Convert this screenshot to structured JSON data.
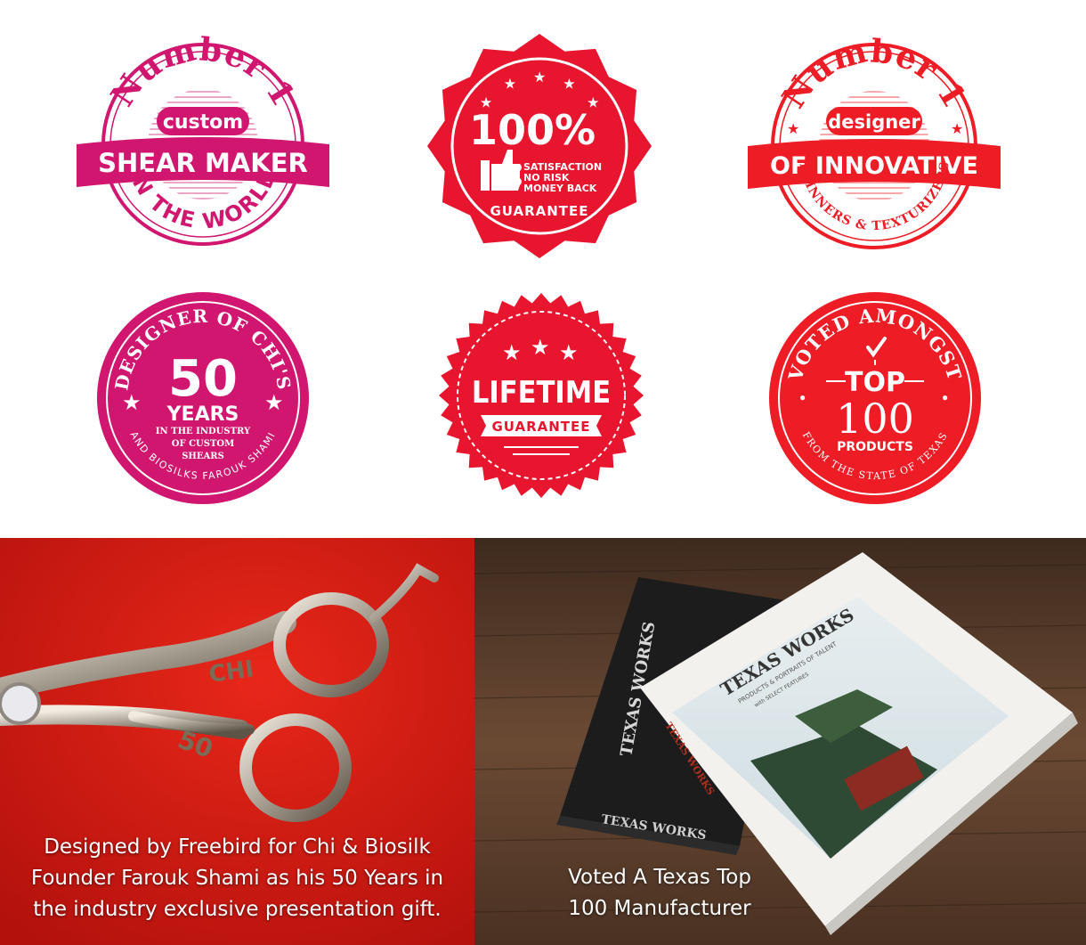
{
  "colors": {
    "magenta": "#d0166f",
    "red": "#e8152e",
    "bright_red": "#ee1c25",
    "white": "#ffffff",
    "photo_red": "#d8190f",
    "wood": "#5a3c2a"
  },
  "badges": {
    "shear_maker": {
      "top_arc": "Number 1",
      "middle_small": "custom",
      "ribbon": "SHEAR MAKER",
      "bottom_arc": "IN THE WORLD"
    },
    "satisfaction": {
      "percent": "100%",
      "lines": [
        "SATISFACTION",
        "NO RISK",
        "MONEY BACK"
      ],
      "bottom": "GUARANTEE",
      "stars": 5,
      "icon": "thumbs-up-icon"
    },
    "innovative": {
      "top_arc": "Number 1",
      "middle_small": "designer",
      "ribbon": "OF INNOVATIVE",
      "bottom_arc": "THINNERS & TEXTURIZERS"
    },
    "fifty_years": {
      "top_arc": "DESIGNER OF CHI'S",
      "number": "50",
      "word": "YEARS",
      "lines": [
        "IN THE INDUSTRY",
        "OF CUSTOM",
        "SHEARS"
      ],
      "bottom_arc": "AND BIOSILKS FAROUK SHAMI"
    },
    "lifetime": {
      "stars": 3,
      "title": "LIFETIME",
      "ribbon": "GUARANTEE"
    },
    "top100": {
      "top_arc": "VOTED AMONGST",
      "top": "TOP",
      "number": "100",
      "products": "PRODUCTS",
      "bottom_arc": "FROM THE STATE OF TEXAS",
      "icon": "checkmark-icon"
    }
  },
  "photos": {
    "scissors": {
      "engraving": "CHI",
      "number": "50",
      "caption_lines": [
        "Designed by Freebird for Chi & Biosilk",
        "Founder Farouk Shami as his 50 Years in",
        "the industry exclusive presentation gift."
      ]
    },
    "book": {
      "cover_title": "TEXAS WORKS",
      "cover_subtitle": "PRODUCTS & PORTRAITS OF TALENT",
      "cover_subtitle2": "with SELECT FEATURES",
      "spine_title": "TEXAS WORKS",
      "back_book_spine": "TEXAS WORKS",
      "back_book_front": "TEXAS WORKS",
      "caption_lines": [
        "Voted A Texas Top",
        "100 Manufacturer"
      ]
    }
  }
}
